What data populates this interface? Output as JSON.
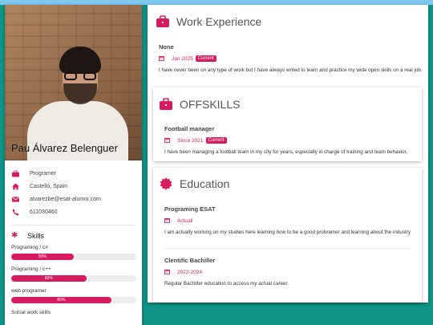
{
  "profile": {
    "name": "Pau Álvarez Belenguer",
    "contact": [
      {
        "icon": "briefcase-icon",
        "text": "Programer"
      },
      {
        "icon": "home-icon",
        "text": "Castelló, Spain"
      },
      {
        "icon": "envelope-icon",
        "text": "alvarezbe@esat-alumni.com"
      },
      {
        "icon": "phone-icon",
        "text": "611030460"
      }
    ],
    "skills_title": "Skills",
    "skills": [
      {
        "label": "Programing / c#",
        "percent": 50,
        "percent_text": "50%"
      },
      {
        "label": "Programing / c++",
        "percent": 60,
        "percent_text": "60%"
      },
      {
        "label": "web programer",
        "percent": 80,
        "percent_text": "80%"
      },
      {
        "label": "Social work skills",
        "percent": 0,
        "percent_text": ""
      }
    ]
  },
  "work": {
    "title": "Work Experience",
    "entries": [
      {
        "title": "None",
        "date": "Jan 2025",
        "badge": "Current",
        "desc": "I have never been on any type of work but I have always wnted to learn and practice my wide open skills on a real job."
      }
    ]
  },
  "offskills": {
    "title": "OFFSKILLS",
    "entries": [
      {
        "title": "Football manager",
        "date": "Since 2021",
        "badge": "Current",
        "desc": "I have been managing a football team in my city for years, especially in charge of training and team behavior."
      }
    ]
  },
  "education": {
    "title": "Education",
    "entries": [
      {
        "title": "Programing ESAT",
        "date": "Actuall",
        "desc": "I am actually working on my studies here learning how to be a good probramer and learning about the industry"
      },
      {
        "title": "Clentific Bachiller",
        "date": "2022-2024",
        "desc": "Regular Bachiller education to access my actual career."
      }
    ]
  },
  "colors": {
    "accent": "#d81b60",
    "background": "#0f9488",
    "top_strip": "#7fc8f0"
  }
}
